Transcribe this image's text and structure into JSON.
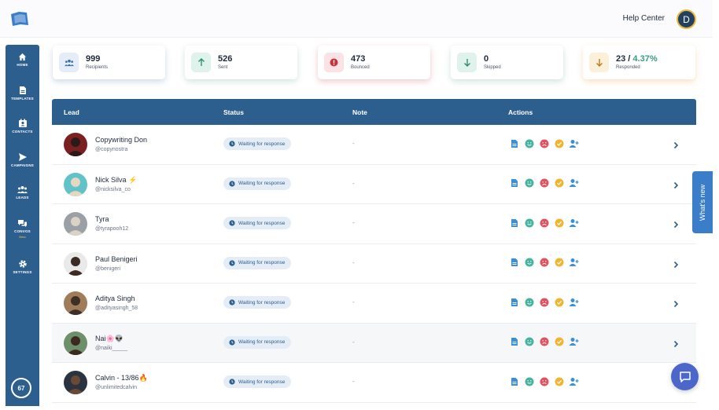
{
  "topbar": {
    "help_label": "Help Center",
    "user_initial": "D"
  },
  "sidebar": {
    "items": [
      {
        "label": "HOME",
        "icon": "home-icon"
      },
      {
        "label": "TEMPLATES",
        "icon": "document-icon"
      },
      {
        "label": "CONTACTS",
        "icon": "contacts-icon"
      },
      {
        "label": "CAMPAIGNS",
        "icon": "send-icon"
      },
      {
        "label": "LEADS",
        "icon": "leads-icon"
      },
      {
        "label": "CONVOS",
        "icon": "chat-icon",
        "badge": "Beta"
      },
      {
        "label": "SETTINGS",
        "icon": "gear-icon"
      }
    ],
    "credits": "67"
  },
  "stats": [
    {
      "value": "999",
      "label": "Recipients",
      "icon": "users-icon",
      "color": "#3d6fa5",
      "bg": "#e5eef8"
    },
    {
      "value": "526",
      "label": "Sent",
      "icon": "arrow-up-icon",
      "color": "#2f8d6f",
      "bg": "#dff3ec"
    },
    {
      "value": "473",
      "label": "Bounced",
      "icon": "alert-icon",
      "color": "#c92f3d",
      "bg": "#fbe3e5"
    },
    {
      "value": "0",
      "label": "Skipped",
      "icon": "arrow-down-icon",
      "color": "#2f8d6f",
      "bg": "#dff3ec"
    },
    {
      "value": "23 / ",
      "value_accent": "4.37%",
      "label": "Responded",
      "icon": "arrow-down-icon",
      "color": "#b97d1c",
      "bg": "#fbf0d9"
    }
  ],
  "table": {
    "headers": {
      "lead": "Lead",
      "status": "Status",
      "note": "Note",
      "actions": "Actions"
    },
    "rows": [
      {
        "name": "Copywriting Don",
        "handle": "@copynostra",
        "status": "Waiting for response",
        "note": "-"
      },
      {
        "name": "Nick Silva ⚡",
        "handle": "@nicksilva_co",
        "status": "Waiting for response",
        "note": "-"
      },
      {
        "name": "Tyra",
        "handle": "@tyrapooh12",
        "status": "Waiting for response",
        "note": "-"
      },
      {
        "name": "Paul Benigeri",
        "handle": "@benigeri",
        "status": "Waiting for response",
        "note": "-"
      },
      {
        "name": "Aditya Singh",
        "handle": "@adityasingh_58",
        "status": "Waiting for response",
        "note": "-"
      },
      {
        "name": "Nai🌸👽",
        "handle": "@naiki_____",
        "status": "Waiting for response",
        "note": "-"
      },
      {
        "name": "Calvin - 13/86🔥",
        "handle": "@unlimitedcalvin",
        "status": "Waiting for response",
        "note": "-"
      }
    ]
  },
  "whats_new_label": "What's new"
}
